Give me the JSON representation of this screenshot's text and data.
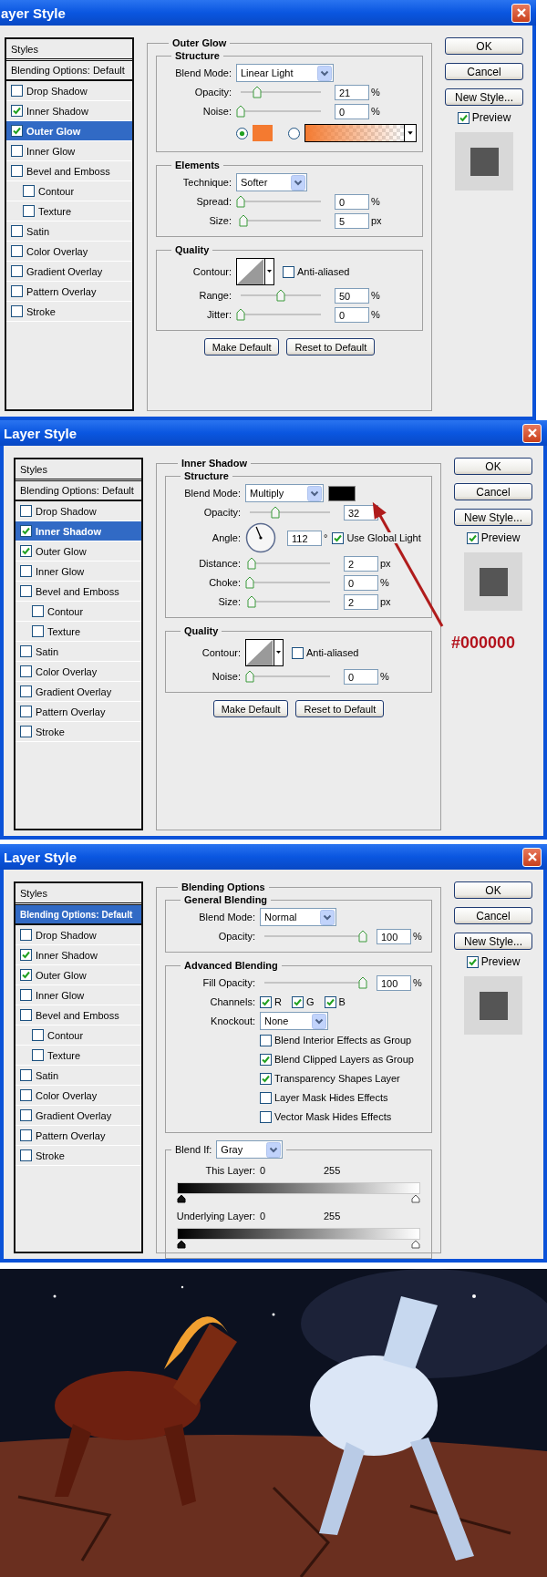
{
  "dialogs": [
    {
      "title": "ayer Style",
      "styles": [
        {
          "label": "Styles",
          "kind": "header",
          "selected": false
        },
        {
          "label": "Blending Options: Default",
          "kind": "option",
          "selected": false
        },
        {
          "label": "Drop Shadow",
          "kind": "effect",
          "checked": false,
          "selected": false
        },
        {
          "label": "Inner Shadow",
          "kind": "effect",
          "checked": true,
          "selected": false
        },
        {
          "label": "Outer Glow",
          "kind": "effect",
          "checked": true,
          "selected": true
        },
        {
          "label": "Inner Glow",
          "kind": "effect",
          "checked": false,
          "selected": false
        },
        {
          "label": "Bevel and Emboss",
          "kind": "effect",
          "checked": false,
          "selected": false,
          "children": [
            {
              "label": "Contour",
              "kind": "effect",
              "checked": false,
              "selected": false
            },
            {
              "label": "Texture",
              "kind": "effect",
              "checked": false,
              "selected": false
            }
          ]
        },
        {
          "label": "Satin",
          "kind": "effect",
          "checked": false,
          "selected": false
        },
        {
          "label": "Color Overlay",
          "kind": "effect",
          "checked": false,
          "selected": false
        },
        {
          "label": "Gradient Overlay",
          "kind": "effect",
          "checked": false,
          "selected": false
        },
        {
          "label": "Pattern Overlay",
          "kind": "effect",
          "checked": false,
          "selected": false
        },
        {
          "label": "Stroke",
          "kind": "effect",
          "checked": false,
          "selected": false
        }
      ],
      "panel": {
        "title": "Outer Glow",
        "sections": [
          {
            "title": "Structure",
            "rows": [
              {
                "kind": "select",
                "label": "Blend Mode:",
                "value": "Linear Light"
              },
              {
                "kind": "slider",
                "label": "Opacity:",
                "level": 0.21,
                "value": "21",
                "unit": "%"
              },
              {
                "kind": "slider",
                "label": "Noise:",
                "level": 0,
                "value": "0",
                "unit": "%"
              },
              {
                "kind": "color_choice",
                "color": "#f47a30",
                "options": [
                  {
                    "kind": "solid",
                    "selected": true
                  },
                  {
                    "kind": "gradient",
                    "selected": false
                  }
                ]
              }
            ]
          },
          {
            "title": "Elements",
            "rows": [
              {
                "kind": "select",
                "label": "Technique:",
                "value": "Softer"
              },
              {
                "kind": "slider",
                "label": "Spread:",
                "level": 0,
                "value": "0",
                "unit": "%"
              },
              {
                "kind": "slider",
                "label": "Size:",
                "level": 0.03,
                "value": "5",
                "unit": "px"
              }
            ]
          },
          {
            "title": "Quality",
            "rows": [
              {
                "kind": "contour",
                "label": "Contour:",
                "option": {
                  "label": "Anti-aliased",
                  "checked": false
                }
              },
              {
                "kind": "slider",
                "label": "Range:",
                "level": 0.5,
                "value": "50",
                "unit": "%"
              },
              {
                "kind": "slider",
                "label": "Jitter:",
                "level": 0,
                "value": "0",
                "unit": "%"
              }
            ]
          }
        ],
        "actions": [
          "Make Default",
          "Reset to Default"
        ]
      },
      "buttons": [
        "OK",
        "Cancel",
        "New Style..."
      ],
      "preview": {
        "label": "Preview",
        "checked": true
      }
    },
    {
      "title": "Layer Style",
      "styles": [
        {
          "label": "Styles",
          "kind": "header",
          "selected": false
        },
        {
          "label": "Blending Options: Default",
          "kind": "option",
          "selected": false
        },
        {
          "label": "Drop Shadow",
          "kind": "effect",
          "checked": false,
          "selected": false
        },
        {
          "label": "Inner Shadow",
          "kind": "effect",
          "checked": true,
          "selected": true
        },
        {
          "label": "Outer Glow",
          "kind": "effect",
          "checked": true,
          "selected": false
        },
        {
          "label": "Inner Glow",
          "kind": "effect",
          "checked": false,
          "selected": false
        },
        {
          "label": "Bevel and Emboss",
          "kind": "effect",
          "checked": false,
          "selected": false,
          "children": [
            {
              "label": "Contour",
              "kind": "effect",
              "checked": false,
              "selected": false
            },
            {
              "label": "Texture",
              "kind": "effect",
              "checked": false,
              "selected": false
            }
          ]
        },
        {
          "label": "Satin",
          "kind": "effect",
          "checked": false,
          "selected": false
        },
        {
          "label": "Color Overlay",
          "kind": "effect",
          "checked": false,
          "selected": false
        },
        {
          "label": "Gradient Overlay",
          "kind": "effect",
          "checked": false,
          "selected": false
        },
        {
          "label": "Pattern Overlay",
          "kind": "effect",
          "checked": false,
          "selected": false
        },
        {
          "label": "Stroke",
          "kind": "effect",
          "checked": false,
          "selected": false
        }
      ],
      "panel": {
        "title": "Inner Shadow",
        "sections": [
          {
            "title": "Structure",
            "rows": [
              {
                "kind": "select",
                "label": "Blend Mode:",
                "value": "Multiply",
                "color": "#000000"
              },
              {
                "kind": "slider",
                "label": "Opacity:",
                "level": 0.32,
                "value": "32"
              },
              {
                "kind": "dial",
                "label": "Angle:",
                "value": "112",
                "unit": "°",
                "option": {
                  "label": "Use Global Light",
                  "checked": true
                }
              },
              {
                "kind": "slider",
                "label": "Distance:",
                "level": 0.02,
                "value": "2",
                "unit": "px"
              },
              {
                "kind": "slider",
                "label": "Choke:",
                "level": 0,
                "value": "0",
                "unit": "%"
              },
              {
                "kind": "slider",
                "label": "Size:",
                "level": 0.02,
                "value": "2",
                "unit": "px"
              }
            ]
          },
          {
            "title": "Quality",
            "rows": [
              {
                "kind": "contour",
                "label": "Contour:",
                "option": {
                  "label": "Anti-aliased",
                  "checked": false
                }
              },
              {
                "kind": "slider",
                "label": "Noise:",
                "level": 0,
                "value": "0",
                "unit": "%"
              }
            ]
          }
        ],
        "actions": [
          "Make Default",
          "Reset to Default"
        ]
      },
      "buttons": [
        "OK",
        "Cancel",
        "New Style..."
      ],
      "preview": {
        "label": "Preview",
        "checked": true
      },
      "annotation": {
        "text": "#000000"
      }
    },
    {
      "title": "Layer Style",
      "styles": [
        {
          "label": "Styles",
          "kind": "header",
          "selected": false
        },
        {
          "label": "Blending Options: Default",
          "kind": "option",
          "selected": true
        },
        {
          "label": "Drop Shadow",
          "kind": "effect",
          "checked": false,
          "selected": false
        },
        {
          "label": "Inner Shadow",
          "kind": "effect",
          "checked": true,
          "selected": false
        },
        {
          "label": "Outer Glow",
          "kind": "effect",
          "checked": true,
          "selected": false
        },
        {
          "label": "Inner Glow",
          "kind": "effect",
          "checked": false,
          "selected": false
        },
        {
          "label": "Bevel and Emboss",
          "kind": "effect",
          "checked": false,
          "selected": false,
          "children": [
            {
              "label": "Contour",
              "kind": "effect",
              "checked": false,
              "selected": false
            },
            {
              "label": "Texture",
              "kind": "effect",
              "checked": false,
              "selected": false
            }
          ]
        },
        {
          "label": "Satin",
          "kind": "effect",
          "checked": false,
          "selected": false
        },
        {
          "label": "Color Overlay",
          "kind": "effect",
          "checked": false,
          "selected": false
        },
        {
          "label": "Gradient Overlay",
          "kind": "effect",
          "checked": false,
          "selected": false
        },
        {
          "label": "Pattern Overlay",
          "kind": "effect",
          "checked": false,
          "selected": false
        },
        {
          "label": "Stroke",
          "kind": "effect",
          "checked": false,
          "selected": false
        }
      ],
      "panel": {
        "title": "Blending Options",
        "sections": [
          {
            "title": "General Blending",
            "rows": [
              {
                "kind": "select",
                "label": "Blend Mode:",
                "value": "Normal"
              },
              {
                "kind": "slider",
                "label": "Opacity:",
                "level": 1,
                "value": "100",
                "unit": "%"
              }
            ]
          },
          {
            "title": "Advanced Blending",
            "rows": [
              {
                "kind": "slider",
                "label": "Fill Opacity:",
                "level": 1,
                "value": "100",
                "unit": "%"
              },
              {
                "kind": "channels",
                "label": "Channels:",
                "options": [
                  {
                    "label": "R",
                    "checked": true
                  },
                  {
                    "label": "G",
                    "checked": true
                  },
                  {
                    "label": "B",
                    "checked": true
                  }
                ]
              },
              {
                "kind": "select",
                "label": "Knockout:",
                "value": "None"
              },
              {
                "kind": "checkbox",
                "label": "Blend Interior Effects as Group",
                "checked": false
              },
              {
                "kind": "checkbox",
                "label": "Blend Clipped Layers as Group",
                "checked": true
              },
              {
                "kind": "checkbox",
                "label": "Transparency Shapes Layer",
                "checked": true
              },
              {
                "kind": "checkbox",
                "label": "Layer Mask Hides Effects",
                "checked": false
              },
              {
                "kind": "checkbox",
                "label": "Vector Mask Hides Effects",
                "checked": false
              }
            ]
          },
          {
            "header": {
              "label": "Blend If:",
              "value": "Gray"
            },
            "rows": [
              {
                "kind": "blend_bar",
                "label": "This Layer:",
                "low": "0",
                "high": "255"
              },
              {
                "kind": "blend_bar",
                "label": "Underlying Layer:",
                "low": "0",
                "high": "255"
              }
            ]
          }
        ]
      },
      "buttons": [
        "OK",
        "Cancel",
        "New Style..."
      ],
      "preview": {
        "label": "Preview",
        "checked": true
      }
    }
  ]
}
